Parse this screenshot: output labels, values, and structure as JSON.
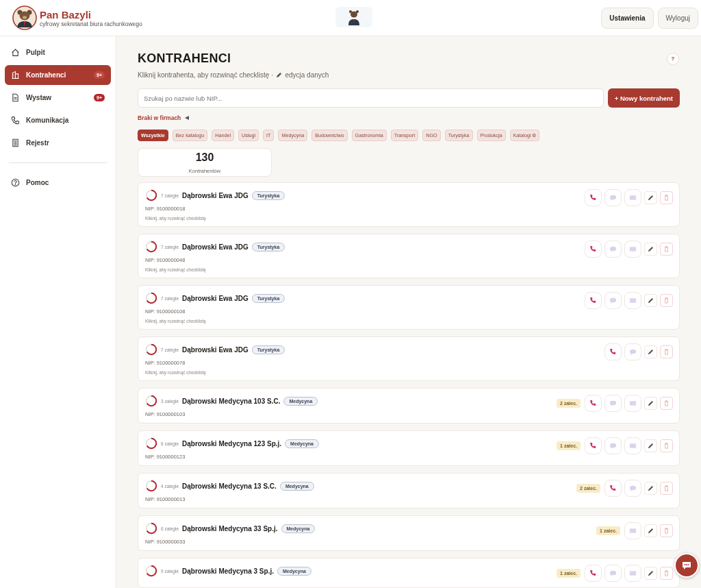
{
  "brand": {
    "name": "Pan Bazyli",
    "tagline": "cyfrowy sekretariat biura rachunkowego"
  },
  "header_buttons": [
    "Ustawienia",
    "Wyloguj"
  ],
  "sidebar": {
    "items": [
      {
        "label": "Pulpit",
        "selected": false
      },
      {
        "label": "Kontrahenci",
        "selected": true,
        "badge": "9+"
      },
      {
        "label": "Wystaw",
        "selected": false,
        "badge": "9+"
      },
      {
        "label": "Komunikacja",
        "selected": false
      },
      {
        "label": "Rejestr",
        "selected": false
      }
    ],
    "footer_items": [
      {
        "label": "Pomoc",
        "selected": false
      }
    ]
  },
  "page": {
    "title": "KONTRAHENCI",
    "help": "?",
    "subtitle_before": "Kliknij kontrahenta, aby rozwinąć checklistę ·",
    "subtitle_after": "edycja danych"
  },
  "search": {
    "placeholder": "Szukaj po nazwie lub NIP..."
  },
  "new_button": "+ Nowy kontrahent",
  "missing_toggle": {
    "label": "Braki w firmach",
    "expanded": false
  },
  "filters": [
    {
      "label": "Wszystkie",
      "selected": true
    },
    {
      "label": "Bez katalogu",
      "selected": false
    },
    {
      "label": "Handel",
      "selected": false
    },
    {
      "label": "Usługi",
      "selected": false
    },
    {
      "label": "IT",
      "selected": false
    },
    {
      "label": "Medycyna",
      "selected": false
    },
    {
      "label": "Budownictwo",
      "selected": false
    },
    {
      "label": "Gastronomia",
      "selected": false
    },
    {
      "label": "Transport",
      "selected": false
    },
    {
      "label": "NGO",
      "selected": false
    },
    {
      "label": "Turystyka",
      "selected": false
    },
    {
      "label": "Produkcja",
      "selected": false
    },
    {
      "label": "Katalogi ⚙",
      "selected": false
    }
  ],
  "stat": {
    "value": "130",
    "label": "Kontrahentów"
  },
  "rows": [
    {
      "overdue": "7 zaległe",
      "name": "Dąbrowski Ewa JDG",
      "tag": "Turystyka",
      "nip": "NIP: 9100000018",
      "hint": "Kliknij, aby rozwinąć checklistę",
      "phone": true,
      "chat": true,
      "mail": true
    },
    {
      "overdue": "7 zaległe",
      "name": "Dąbrowski Ewa JDG",
      "tag": "Turystyka",
      "nip": "NIP: 9100000048",
      "hint": "Kliknij, aby rozwinąć checklistę",
      "phone": true,
      "chat": true,
      "mail": true
    },
    {
      "overdue": "7 zaległe",
      "name": "Dąbrowski Ewa JDG",
      "tag": "Turystyka",
      "nip": "NIP: 9100000108",
      "hint": "Kliknij, aby rozwinąć checklistę",
      "phone": true,
      "chat": true,
      "mail": true
    },
    {
      "overdue": "7 zaległe",
      "name": "Dąbrowski Ewa JDG",
      "tag": "Turystyka",
      "nip": "NIP: 9100000078",
      "hint": "Kliknij, aby rozwinąć checklistę",
      "phone": true,
      "chat": true,
      "mail": false
    },
    {
      "overdue": "3 zaległe",
      "name": "Dąbrowski Medycyna 103 S.C.",
      "tag": "Medycyna",
      "nip": "NIP: 9100000103",
      "badge": "2 zalec.",
      "phone": true,
      "chat": true,
      "mail": true
    },
    {
      "overdue": "6 zaległe",
      "name": "Dąbrowski Medycyna 123 Sp.j.",
      "tag": "Medycyna",
      "nip": "NIP: 9100000123",
      "badge": "1 zalec.",
      "phone": true,
      "chat": true,
      "mail": true
    },
    {
      "overdue": "4 zaległe",
      "name": "Dąbrowski Medycyna 13 S.C.",
      "tag": "Medycyna",
      "nip": "NIP: 9100000013",
      "badge": "2 zalec.",
      "phone": true,
      "chat": true,
      "mail": false
    },
    {
      "overdue": "6 zaległe",
      "name": "Dąbrowski Medycyna 33 Sp.j.",
      "tag": "Medycyna",
      "nip": "NIP: 9100000033",
      "badge": "1 zalec.",
      "phone": false,
      "chat": false,
      "mail": true
    },
    {
      "overdue": "9 zaległe",
      "name": "Dąbrowski Medycyna 3 Sp.j.",
      "tag": "Medycyna",
      "badge": "1 zalec.",
      "phone": true,
      "chat": true,
      "mail": true
    }
  ]
}
